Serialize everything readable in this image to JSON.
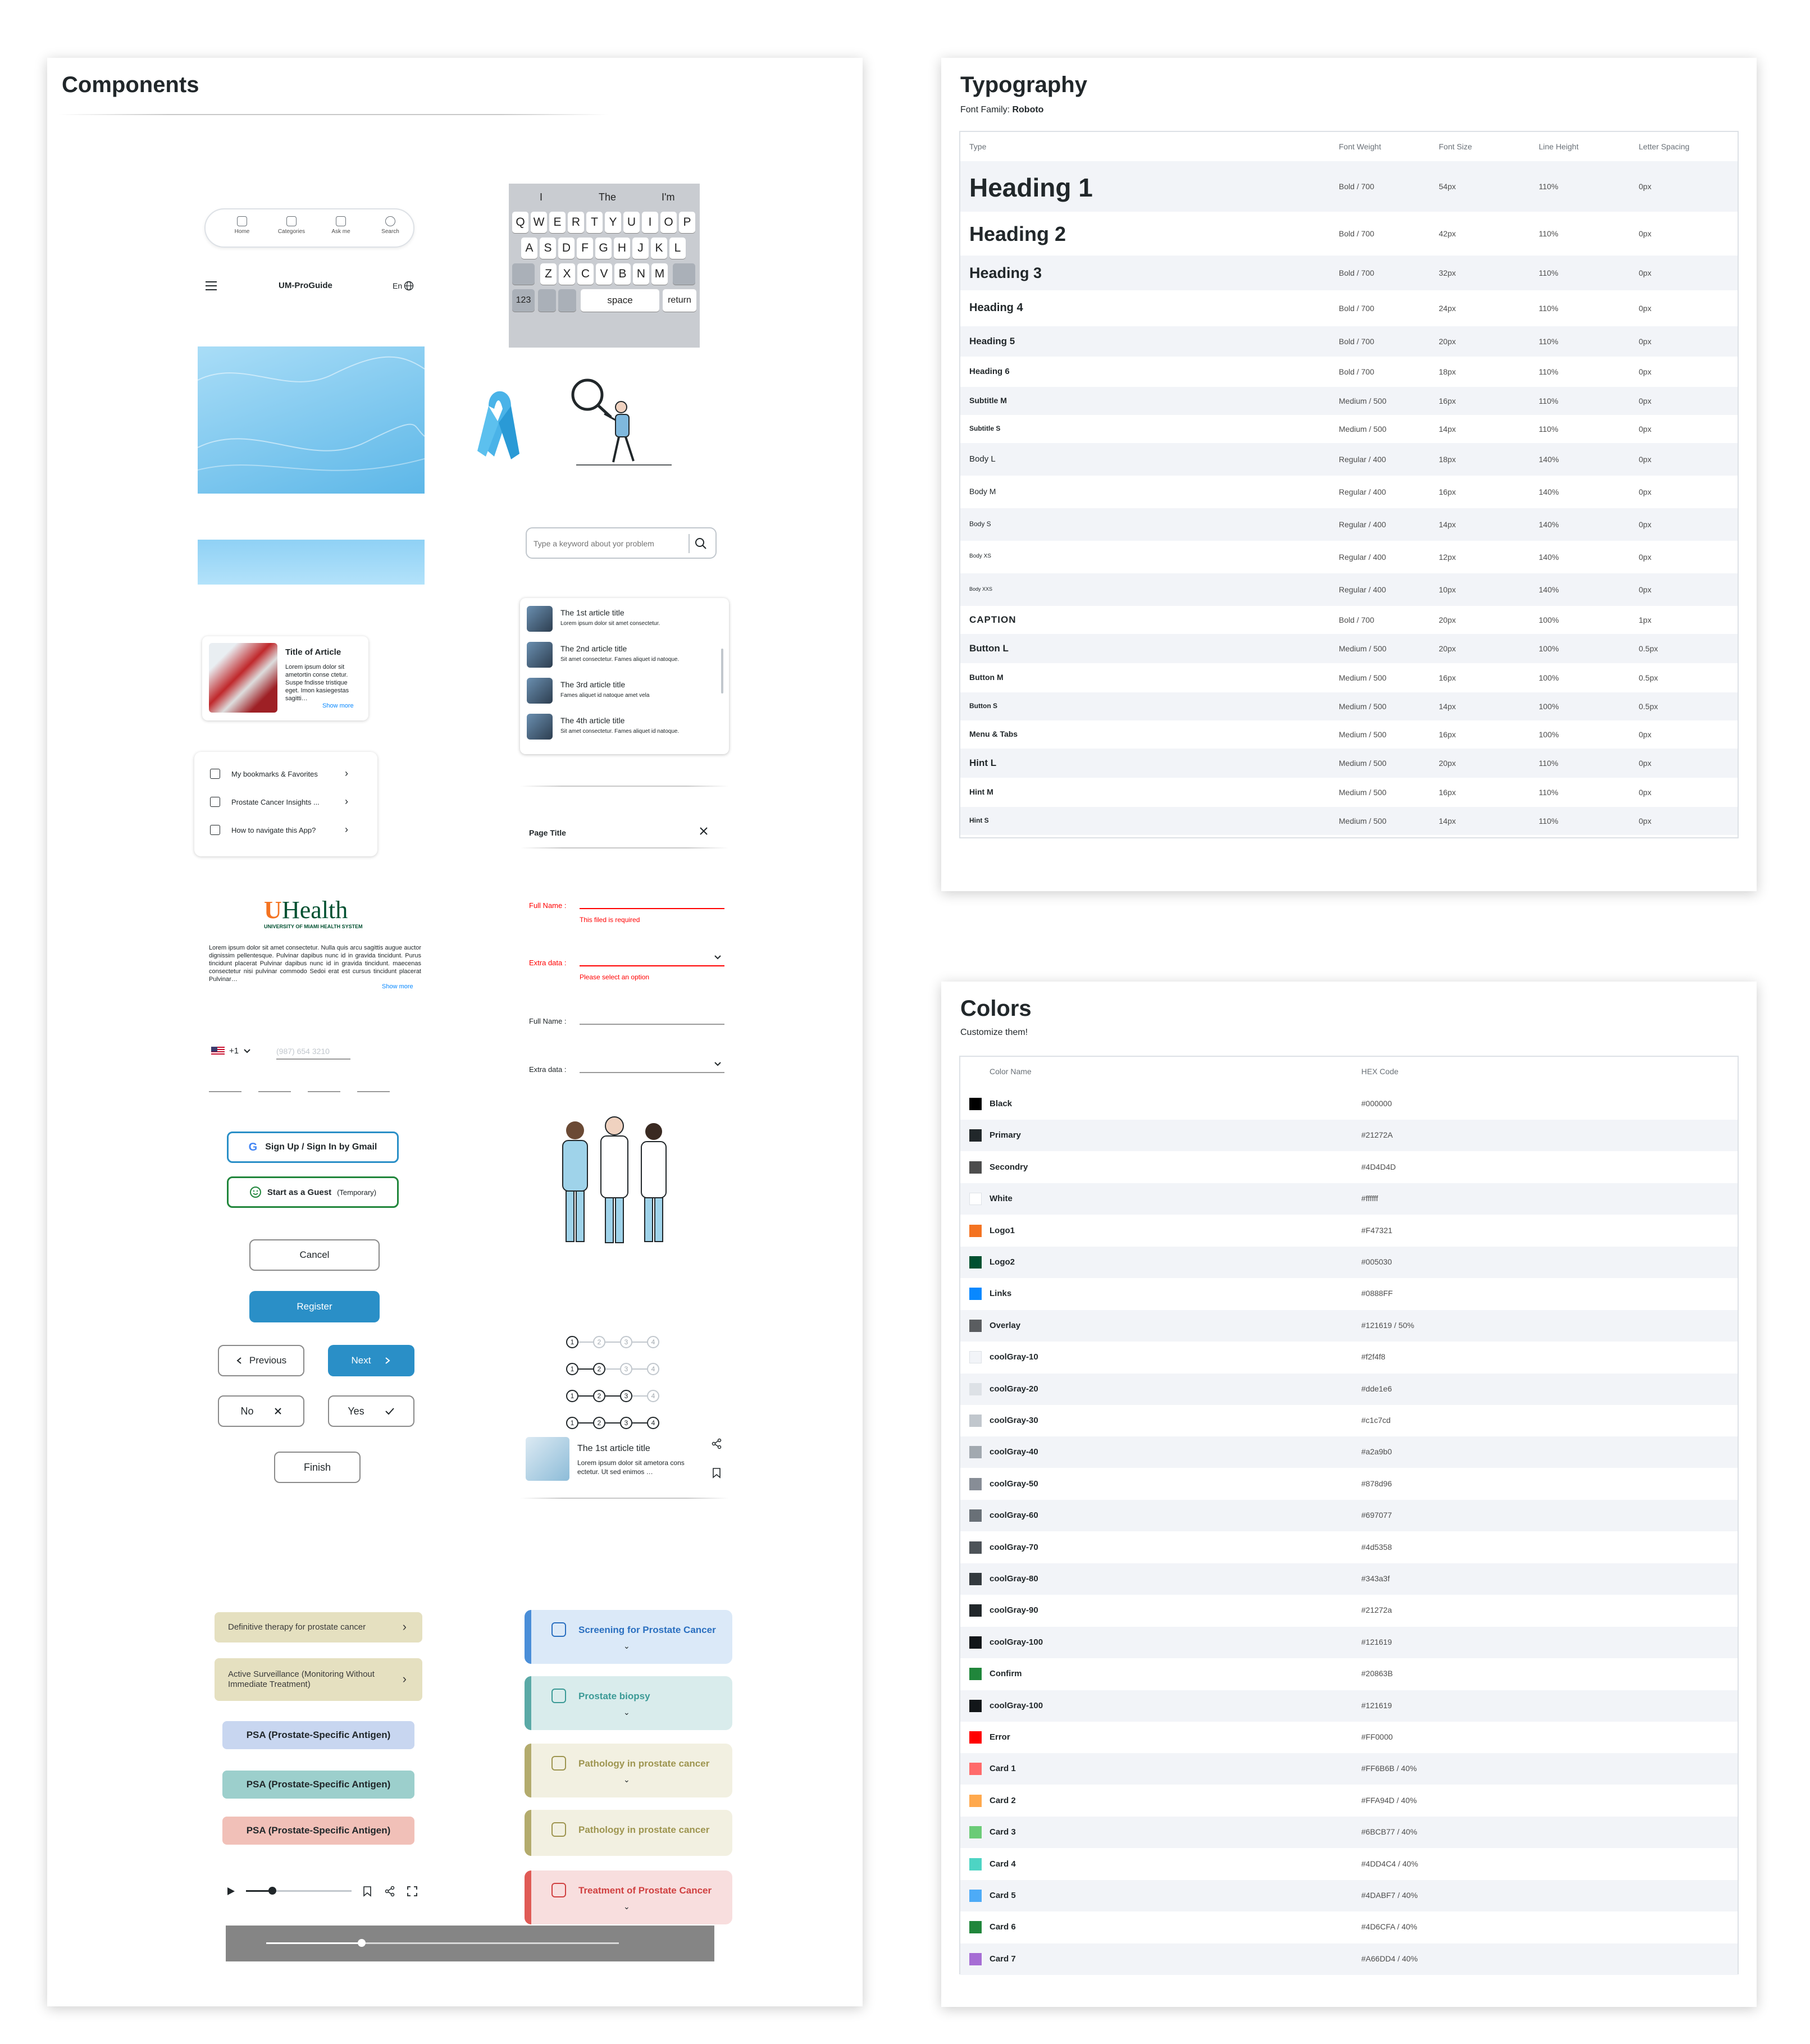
{
  "components": {
    "title": "Components",
    "bottom_nav": [
      {
        "label": "Home",
        "icon": "home-icon"
      },
      {
        "label": "Categories",
        "icon": "categories-icon"
      },
      {
        "label": "Ask me",
        "icon": "sparkle-icon"
      },
      {
        "label": "Search",
        "icon": "search-icon"
      }
    ],
    "header": {
      "title": "UM-ProGuide",
      "lang": "En"
    },
    "keyboard": {
      "suggestions": [
        "I",
        "The",
        "I'm"
      ],
      "row1": [
        "Q",
        "W",
        "E",
        "R",
        "T",
        "Y",
        "U",
        "I",
        "O",
        "P"
      ],
      "row2": [
        "A",
        "S",
        "D",
        "F",
        "G",
        "H",
        "J",
        "K",
        "L"
      ],
      "row3": [
        "Z",
        "X",
        "C",
        "V",
        "B",
        "N",
        "M"
      ],
      "num": "123",
      "space": "space",
      "return": "return"
    },
    "search": {
      "placeholder": "Type a keyword about yor problem"
    },
    "article_card": {
      "title": "Title of Article",
      "body": "Lorem ipsum dolor sit ametortin conse ctetur. Suspe fndisse tristique eget. Imon kasiegestas sagitti…",
      "more": "Show more"
    },
    "article_list": [
      {
        "title": "The 1st article title",
        "desc": "Lorem ipsum dolor sit amet consectetur."
      },
      {
        "title": "The 2nd article title",
        "desc": "Sit amet consectetur. Fames aliquet id natoque."
      },
      {
        "title": "The 3rd article title",
        "desc": "Fames aliquet id natoque amet vela"
      },
      {
        "title": "The 4th article title",
        "desc": "Sit amet consectetur. Fames aliquet id natoque."
      }
    ],
    "menu": [
      {
        "label": "My bookmarks & Favorites",
        "icon": "bookmark-icon"
      },
      {
        "label": "Prostate Cancer Insights ...",
        "icon": "ribbon-icon"
      },
      {
        "label": "How to navigate this App?",
        "icon": "lightbulb-icon"
      }
    ],
    "modal": {
      "title": "Page Title"
    },
    "form": {
      "full_name": "Full Name :",
      "full_name_error": "This filed is required",
      "extra_data": "Extra data :",
      "extra_data_error": "Please select an option",
      "full_name2": "Full Name :",
      "extra_data2": "Extra data :"
    },
    "logo": {
      "wordmark": "Health",
      "letter": "U",
      "subtitle": "UNIVERSITY OF MIAMI HEALTH SYSTEM"
    },
    "about": {
      "text": "Lorem ipsum dolor sit amet consectetur. Nulla quis arcu sagittis augue auctor dignissim pellentesque. Pulvinar dapibus nunc id in gravida tincidunt. Purus tincidunt placerat Pulvinar dapibus nunc id in gravida tincidunt. maecenas consectetur nisi pulvinar commodo Sedoi erat est cursus tincidunt placerat Pulvinar…",
      "more": "Show more"
    },
    "phone": {
      "code": "+1",
      "placeholder": "(987) 654 3210"
    },
    "buttons": {
      "gmail": "Sign Up / Sign In by Gmail",
      "guest": "Start as a Guest",
      "guest_note": "(Temporary)",
      "cancel": "Cancel",
      "register": "Register",
      "previous": "Previous",
      "next": "Next",
      "no": "No",
      "yes": "Yes",
      "finish": "Finish"
    },
    "steppers": [
      {
        "active": 1,
        "labels": [
          "1",
          "2",
          "3",
          "4"
        ]
      },
      {
        "active": 2,
        "labels": [
          "1",
          "2",
          "3",
          "4"
        ]
      },
      {
        "active": 3,
        "labels": [
          "1",
          "2",
          "3",
          "4"
        ]
      },
      {
        "active": 4,
        "labels": [
          "1",
          "2",
          "3",
          "4"
        ]
      }
    ],
    "share_card": {
      "title": "The 1st article title",
      "desc": "Lorem ipsum dolor sit ametora cons ectetur. Ut sed enimos …"
    },
    "chips": [
      {
        "label": "Definitive therapy for prostate cancer",
        "color": "#e5e0c0"
      },
      {
        "label": "Active Surveillance (Monitoring Without Immediate Treatment)",
        "color": "#e5e0c0"
      }
    ],
    "psa": [
      {
        "label": "PSA  (Prostate-Specific Antigen)",
        "color": "#c8d6f0"
      },
      {
        "label": "PSA  (Prostate-Specific Antigen)",
        "color": "#9ccfcc"
      },
      {
        "label": "PSA  (Prostate-Specific Antigen)",
        "color": "#f1c0b8"
      }
    ],
    "accordions": [
      {
        "label": "Screening for Prostate Cancer",
        "bg": "#dbe9f8",
        "bar": "#4a8ed8",
        "text": "#2a6fc0",
        "icon": "scan-icon"
      },
      {
        "label": "Prostate biopsy",
        "bg": "#d9ecec",
        "bar": "#5aa9a6",
        "text": "#3b9a96",
        "icon": "microscope-icon"
      },
      {
        "label": "Pathology in prostate cancer",
        "bg": "#f2f0e1",
        "bar": "#b3ab6d",
        "text": "#9e9550",
        "icon": "microscope-icon"
      },
      {
        "label": "Pathology in prostate cancer",
        "bg": "#f2f0e1",
        "bar": "#b3ab6d",
        "text": "#9e9550",
        "icon": "microscope-icon"
      },
      {
        "label": "Treatment of Prostate Cancer",
        "bg": "#f8dede",
        "bar": "#e05a55",
        "text": "#d04040",
        "icon": "pill-icon"
      }
    ],
    "media": {
      "progress": 0.25,
      "slider": 0.27
    }
  },
  "typography": {
    "title": "Typography",
    "font_family_label": "Font Family:",
    "font_family": "Roboto",
    "headers": [
      "Type",
      "Font Weight",
      "Font Size",
      "Line Height",
      "Letter Spacing"
    ],
    "rows": [
      {
        "type": "Heading 1",
        "weight": "Bold / 700",
        "size": "54px",
        "lh": "110%",
        "ls": "0px"
      },
      {
        "type": "Heading 2",
        "weight": "Bold / 700",
        "size": "42px",
        "lh": "110%",
        "ls": "0px"
      },
      {
        "type": "Heading 3",
        "weight": "Bold / 700",
        "size": "32px",
        "lh": "110%",
        "ls": "0px"
      },
      {
        "type": "Heading 4",
        "weight": "Bold / 700",
        "size": "24px",
        "lh": "110%",
        "ls": "0px"
      },
      {
        "type": "Heading 5",
        "weight": "Bold / 700",
        "size": "20px",
        "lh": "110%",
        "ls": "0px"
      },
      {
        "type": "Heading 6",
        "weight": "Bold / 700",
        "size": "18px",
        "lh": "110%",
        "ls": "0px"
      },
      {
        "type": "Subtitle M",
        "weight": "Medium / 500",
        "size": "16px",
        "lh": "110%",
        "ls": "0px"
      },
      {
        "type": "Subtitle S",
        "weight": "Medium / 500",
        "size": "14px",
        "lh": "110%",
        "ls": "0px"
      },
      {
        "type": "Body L",
        "weight": "Regular / 400",
        "size": "18px",
        "lh": "140%",
        "ls": "0px"
      },
      {
        "type": "Body M",
        "weight": "Regular / 400",
        "size": "16px",
        "lh": "140%",
        "ls": "0px"
      },
      {
        "type": "Body S",
        "weight": "Regular / 400",
        "size": "14px",
        "lh": "140%",
        "ls": "0px"
      },
      {
        "type": "Body XS",
        "weight": "Regular / 400",
        "size": "12px",
        "lh": "140%",
        "ls": "0px"
      },
      {
        "type": "Body XXS",
        "weight": "Regular / 400",
        "size": "10px",
        "lh": "140%",
        "ls": "0px"
      },
      {
        "type": "CAPTION",
        "weight": "Bold / 700",
        "size": "20px",
        "lh": "100%",
        "ls": "1px"
      },
      {
        "type": "Button L",
        "weight": "Medium / 500",
        "size": "20px",
        "lh": "100%",
        "ls": "0.5px"
      },
      {
        "type": "Button M",
        "weight": "Medium / 500",
        "size": "16px",
        "lh": "100%",
        "ls": "0.5px"
      },
      {
        "type": "Button S",
        "weight": "Medium / 500",
        "size": "14px",
        "lh": "100%",
        "ls": "0.5px"
      },
      {
        "type": "Menu & Tabs",
        "weight": "Medium / 500",
        "size": "16px",
        "lh": "100%",
        "ls": "0px"
      },
      {
        "type": "Hint L",
        "weight": "Medium / 500",
        "size": "20px",
        "lh": "110%",
        "ls": "0px"
      },
      {
        "type": "Hint M",
        "weight": "Medium / 500",
        "size": "16px",
        "lh": "110%",
        "ls": "0px"
      },
      {
        "type": "Hint S",
        "weight": "Medium / 500",
        "size": "14px",
        "lh": "110%",
        "ls": "0px"
      }
    ]
  },
  "colors": {
    "title": "Colors",
    "subtitle": "Customize them!",
    "headers": [
      "Color Name",
      "HEX Code"
    ],
    "rows": [
      {
        "name": "Black",
        "hex": "#000000",
        "swatch": "#000000"
      },
      {
        "name": "Primary",
        "hex": "#21272A",
        "swatch": "#21272a"
      },
      {
        "name": "Secondry",
        "hex": "#4D4D4D",
        "swatch": "#4d4d4d"
      },
      {
        "name": "White",
        "hex": "#ffffff",
        "swatch": "#ffffff"
      },
      {
        "name": "Logo1",
        "hex": "#F47321",
        "swatch": "#f47321"
      },
      {
        "name": "Logo2",
        "hex": "#005030",
        "swatch": "#005030"
      },
      {
        "name": "Links",
        "hex": "#0888FF",
        "swatch": "#0888ff"
      },
      {
        "name": "Overlay",
        "hex": "#121619 / 50%",
        "swatch": "#5a5d60"
      },
      {
        "name": "coolGray-10",
        "hex": "#f2f4f8",
        "swatch": "#f2f4f8"
      },
      {
        "name": "coolGray-20",
        "hex": "#dde1e6",
        "swatch": "#dde1e6"
      },
      {
        "name": "coolGray-30",
        "hex": "#c1c7cd",
        "swatch": "#c1c7cd"
      },
      {
        "name": "coolGray-40",
        "hex": "#a2a9b0",
        "swatch": "#a2a9b0"
      },
      {
        "name": "coolGray-50",
        "hex": "#878d96",
        "swatch": "#878d96"
      },
      {
        "name": "coolGray-60",
        "hex": "#697077",
        "swatch": "#697077"
      },
      {
        "name": "coolGray-70",
        "hex": "#4d5358",
        "swatch": "#4d5358"
      },
      {
        "name": "coolGray-80",
        "hex": "#343a3f",
        "swatch": "#343a3f"
      },
      {
        "name": "coolGray-90",
        "hex": "#21272a",
        "swatch": "#21272a"
      },
      {
        "name": "coolGray-100",
        "hex": "#121619",
        "swatch": "#121619"
      },
      {
        "name": "Confirm",
        "hex": "#20863B",
        "swatch": "#20863b"
      },
      {
        "name": "coolGray-100",
        "hex": "#121619",
        "swatch": "#121619"
      },
      {
        "name": "Error",
        "hex": "#FF0000",
        "swatch": "#ff0000"
      },
      {
        "name": "Card 1",
        "hex": "#FF6B6B / 40%",
        "swatch": "#ff6b6b"
      },
      {
        "name": "Card 2",
        "hex": "#FFA94D / 40%",
        "swatch": "#ffa94d"
      },
      {
        "name": "Card 3",
        "hex": "#6BCB77 / 40%",
        "swatch": "#6bcb77"
      },
      {
        "name": "Card 4",
        "hex": "#4DD4C4 / 40%",
        "swatch": "#4dd4c4"
      },
      {
        "name": "Card 5",
        "hex": "#4DABF7 / 40%",
        "swatch": "#4dabf7"
      },
      {
        "name": "Card 6",
        "hex": "#4D6CFA / 40%",
        "swatch": "#20863b"
      },
      {
        "name": "Card 7",
        "hex": "#A66DD4 / 40%",
        "swatch": "#a66dd4"
      }
    ]
  }
}
